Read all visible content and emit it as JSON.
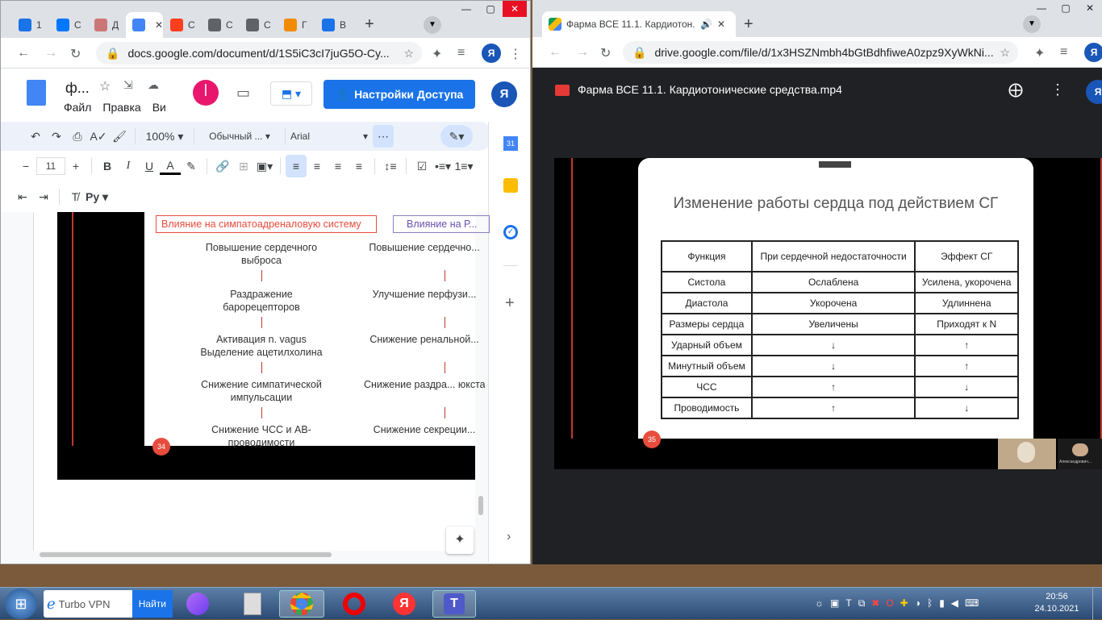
{
  "left_browser": {
    "tabs": [
      {
        "label": "1",
        "icon": "1",
        "color": "#1a73e8"
      },
      {
        "label": "С",
        "icon": "vk",
        "color": "#0077ff"
      },
      {
        "label": "Д",
        "icon": "fox",
        "color": "#c77"
      },
      {
        "label": "",
        "icon": "docs",
        "color": "#4285f4"
      },
      {
        "label": "С",
        "icon": "ya",
        "color": "#fc3f1d"
      },
      {
        "label": "С",
        "icon": "globe",
        "color": "#5f6368"
      },
      {
        "label": "С",
        "icon": "globe",
        "color": "#5f6368"
      },
      {
        "label": "Г",
        "icon": "plus",
        "color": "#f28b00"
      },
      {
        "label": "В",
        "icon": "loading",
        "color": "#1a73e8"
      }
    ],
    "url": "docs.google.com/document/d/1S5iC3cI7juG5O-Cy...",
    "doc_title": "ф...",
    "menu": [
      "Файл",
      "Правка",
      "Ви"
    ],
    "share_label": "Настройки Доступа",
    "avatar": "Я",
    "toolbar": {
      "zoom": "100%",
      "style": "Обычный ...",
      "font": "Arial",
      "size": "11"
    },
    "slide": {
      "left_header": "Влияние на симпатоадреналовую систему",
      "right_header": "Влияние на Р...",
      "left_flow": [
        "Повышение сердечного выброса",
        "Раздражение барорецепторов",
        "Активация n. vagus Выделение ацетилхолина",
        "Снижение симпатической импульсации",
        "Снижение ЧСС и АВ-проводимости"
      ],
      "right_flow": [
        "Повышение сердечно...",
        "Улучшение перфузи...",
        "Снижение ренальной...",
        "Снижение раздра... юкстагломерулярны...",
        "Снижение секреции..."
      ],
      "page_number": "34"
    }
  },
  "right_browser": {
    "tab_title": "Фарма ВСЕ 11.1. Кардиотон...",
    "url": "drive.google.com/file/d/1x3HSZNmbh4bGtBdhfiweA0zpz9XyWkNi...",
    "file_title": "Фарма ВСЕ 11.1. Кардиотонические средства.mp4",
    "slide": {
      "title": "Изменение работы сердца под действием СГ",
      "headers": [
        "Функция",
        "При сердечной недостаточности",
        "Эффект СГ"
      ],
      "rows": [
        [
          "Систола",
          "Ослаблена",
          "Усилена, укорочена"
        ],
        [
          "Диастола",
          "Укорочена",
          "Удлиннена"
        ],
        [
          "Размеры сердца",
          "Увеличены",
          "Приходят к N"
        ],
        [
          "Ударный объем",
          "↓",
          "↑"
        ],
        [
          "Минутный объем",
          "↓",
          "↑"
        ],
        [
          "ЧСС",
          "↑",
          "↓"
        ],
        [
          "Проводимость",
          "↑",
          "↓"
        ]
      ],
      "page_number": "35"
    },
    "participant_label": "Александрович..."
  },
  "taskbar": {
    "vpn_label": "Turbo VPN",
    "vpn_button": "Найти",
    "time": "20:56",
    "date": "24.10.2021"
  }
}
